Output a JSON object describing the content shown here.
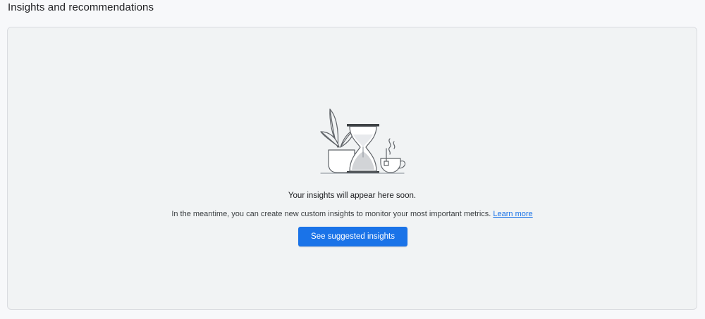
{
  "section": {
    "title": "Insights and recommendations"
  },
  "empty_state": {
    "illustration_icon": "hourglass-plant-tea-illustration",
    "headline": "Your insights will appear here soon.",
    "description": "In the meantime, you can create new custom insights to monitor your most important metrics.",
    "learn_more_label": "Learn more",
    "cta_label": "See suggested insights"
  },
  "colors": {
    "accent": "#1a73e8",
    "card_background": "#f1f3f4",
    "page_background": "#f7f8fa",
    "border": "#dadce0"
  }
}
